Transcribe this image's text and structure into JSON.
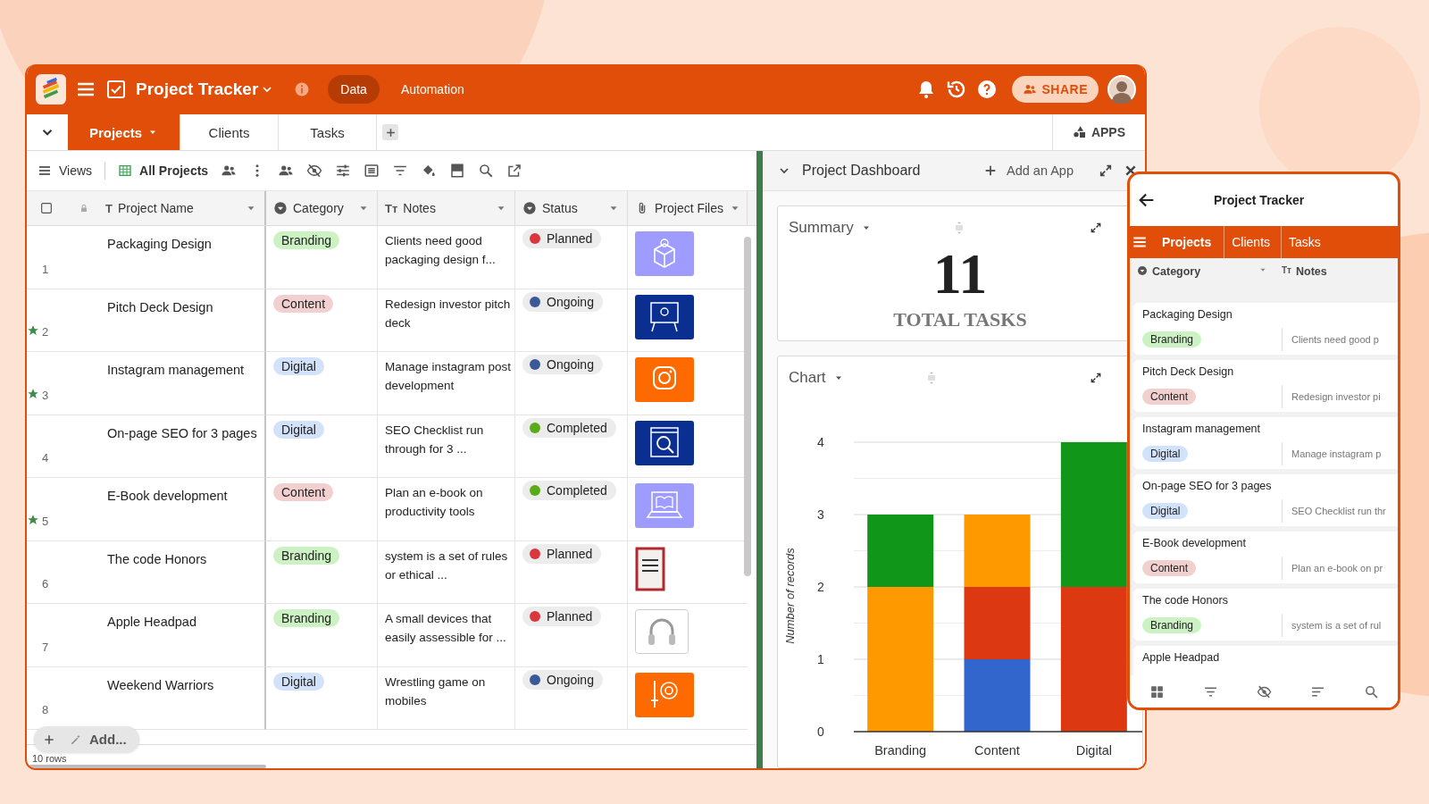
{
  "app": {
    "title": "Project Tracker",
    "nav": [
      {
        "label": "Data",
        "selected": true
      },
      {
        "label": "Automation",
        "selected": false
      }
    ],
    "share": "SHARE"
  },
  "tabs": [
    {
      "label": "Projects",
      "selected": true
    },
    {
      "label": "Clients",
      "selected": false
    },
    {
      "label": "Tasks",
      "selected": false
    }
  ],
  "apps": "APPS",
  "toolbar": {
    "views": "Views",
    "view_name": "All Projects"
  },
  "table": {
    "columns": [
      {
        "label": "Project Name",
        "glyph": "T"
      },
      {
        "label": "Category"
      },
      {
        "label": "Notes",
        "glyph": "Tт"
      },
      {
        "label": "Status"
      },
      {
        "label": "Project Files"
      }
    ],
    "rows": [
      {
        "number": "1",
        "starred": false,
        "name": "Packaging Design",
        "category": {
          "label": "Branding",
          "color": "#ccf2c4"
        },
        "notes": "Clients need good packaging design f...",
        "status": {
          "label": "Planned",
          "color": "#d9363e"
        },
        "file": {
          "kind": "box"
        }
      },
      {
        "number": "2",
        "starred": true,
        "name": "Pitch Deck Design",
        "category": {
          "label": "Content",
          "color": "#f3d0d0"
        },
        "notes": "Redesign investor pitch deck",
        "status": {
          "label": "Ongoing",
          "color": "#3b5998"
        },
        "file": {
          "kind": "board"
        }
      },
      {
        "number": "3",
        "starred": true,
        "name": "Instagram management",
        "category": {
          "label": "Digital",
          "color": "#d3e2fb"
        },
        "notes": "Manage instagram post development",
        "status": {
          "label": "Ongoing",
          "color": "#3b5998"
        },
        "file": {
          "kind": "camera"
        }
      },
      {
        "number": "4",
        "starred": false,
        "name": "On-page SEO for 3 pages",
        "category": {
          "label": "Digital",
          "color": "#d3e2fb"
        },
        "notes": "SEO Checklist run through for 3 ...",
        "status": {
          "label": "Completed",
          "color": "#5aab17"
        },
        "file": {
          "kind": "magnifier"
        }
      },
      {
        "number": "5",
        "starred": true,
        "name": "E-Book development",
        "category": {
          "label": "Content",
          "color": "#f3d0d0"
        },
        "notes": "Plan an e-book on productivity tools",
        "status": {
          "label": "Completed",
          "color": "#5aab17"
        },
        "file": {
          "kind": "ebook"
        }
      },
      {
        "number": "6",
        "starred": false,
        "name": "The code Honors",
        "category": {
          "label": "Branding",
          "color": "#ccf2c4"
        },
        "notes": "system is a set of rules or ethical ...",
        "status": {
          "label": "Planned",
          "color": "#d9363e"
        },
        "file": {
          "kind": "book"
        }
      },
      {
        "number": "7",
        "starred": false,
        "name": "Apple Headpad",
        "category": {
          "label": "Branding",
          "color": "#ccf2c4"
        },
        "notes": "A small devices that easily assessible for ...",
        "status": {
          "label": "Planned",
          "color": "#d9363e"
        },
        "file": {
          "kind": "headphones"
        }
      },
      {
        "number": "8",
        "starred": false,
        "name": "Weekend Warriors",
        "category": {
          "label": "Digital",
          "color": "#d3e2fb"
        },
        "notes": "Wrestling game on mobiles",
        "status": {
          "label": "Ongoing",
          "color": "#3b5998"
        },
        "file": {
          "kind": "sword"
        }
      }
    ],
    "add": "Add...",
    "row_count": "10 rows"
  },
  "dashboard": {
    "title": "Project Dashboard",
    "add_app": "Add an App",
    "summary": {
      "title": "Summary",
      "value": "11",
      "label": "TOTAL TASKS"
    },
    "chart": {
      "title": "Chart",
      "chart_data": {
        "type": "bar",
        "stacked": true,
        "grid": true,
        "ylabel": "Number of records",
        "categories": [
          "Branding",
          "Content",
          "Digital"
        ],
        "ylim": [
          0,
          4
        ],
        "yticks": [
          0,
          1,
          2,
          3,
          4
        ],
        "series": [
          {
            "color": "#3366cc",
            "values": [
              0,
              1,
              0
            ]
          },
          {
            "color": "#dc3912",
            "values": [
              0,
              1,
              2
            ]
          },
          {
            "color": "#ff9900",
            "values": [
              2,
              1,
              0
            ]
          },
          {
            "color": "#109618",
            "values": [
              1,
              0,
              2
            ]
          }
        ]
      }
    }
  },
  "mobile": {
    "title": "Project Tracker",
    "tabs": [
      {
        "label": "Projects",
        "selected": true
      },
      {
        "label": "Clients",
        "selected": false
      },
      {
        "label": "Tasks",
        "selected": false
      }
    ],
    "columns": [
      {
        "label": "Category"
      },
      {
        "label": "Notes",
        "glyph": "Tт"
      }
    ],
    "cards": [
      {
        "name": "Packaging Design",
        "category": {
          "label": "Branding",
          "color": "#ccf2c4"
        },
        "notes": "Clients need good p"
      },
      {
        "name": "Pitch Deck Design",
        "category": {
          "label": "Content",
          "color": "#f3d0d0"
        },
        "notes": "Redesign investor pi"
      },
      {
        "name": "Instagram management",
        "category": {
          "label": "Digital",
          "color": "#d3e2fb"
        },
        "notes": "Manage instagram p"
      },
      {
        "name": "On-page SEO for 3 pages",
        "category": {
          "label": "Digital",
          "color": "#d3e2fb"
        },
        "notes": "SEO Checklist run thr"
      },
      {
        "name": "E-Book development",
        "category": {
          "label": "Content",
          "color": "#f3d0d0"
        },
        "notes": "Plan an e-book on pr"
      },
      {
        "name": "The code Honors",
        "category": {
          "label": "Branding",
          "color": "#ccf2c4"
        },
        "notes": "system is a set of rul"
      },
      {
        "name": "Apple Headpad"
      }
    ]
  }
}
